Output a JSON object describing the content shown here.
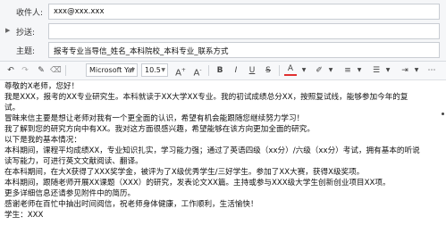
{
  "header": {
    "to": {
      "label": "收件人:",
      "value": "xxx@xxx.xxx"
    },
    "cc": {
      "label": "抄送:",
      "value": ""
    },
    "subject": {
      "label": "主题:",
      "value": "报考专业当导信_姓名_本科院校_本科专业_联系方式"
    }
  },
  "toolbar": {
    "font_family": "Microsoft Yal",
    "font_size": "10.5",
    "items": [
      "undo-icon",
      "redo-icon",
      "format-painter-icon",
      "clear-format-icon",
      "bold-icon",
      "italic-icon",
      "underline-icon",
      "strikethrough-icon",
      "font-color-icon",
      "highlight-icon",
      "align-icon",
      "list-icon",
      "indent-icon",
      "more-icon"
    ]
  },
  "body": {
    "lines": [
      "尊敬的X老师，您好！",
      "   我是XXX，报考的XX专业研究生。本科就读于XX大学XX专业。我的初试成绩总分XX，按照复试线，能够参加今年的复",
      "试。",
      "冒昧来信主要是想让老师对我有一个更全面的认识，希望有机会能跟随您继续努力学习！",
      "我了解到您的研究方向中有XX。我对这方面很感兴趣，希望能够在该方向更加全面的研究。",
      "以下是我的基本情况：",
      "本科期间，课程平均成绩XX，专业知识扎实，学习能力强；通过了英语四级（xx分）/六级（xx分）考试，拥有基本的听说",
      "读写能力，可进行英文文献阅读、翻译。",
      "在本科期间，在大X获得了XXX奖学金，被评为了X级优秀学生/三好学生。参加了XX大赛，获得X级奖项。",
      "本科期间，跟随老师开展XX课题（XXX）的研究，发表论文XX篇。主持或参与XXX级大学生创新创业项目XX项。",
      "更多详细信息还请参见附件中的简历。",
      "感谢老师在百忙中抽出时间阅信，祝老师身体健康，工作顺利，生活愉快！",
      "学生：XXX"
    ]
  }
}
